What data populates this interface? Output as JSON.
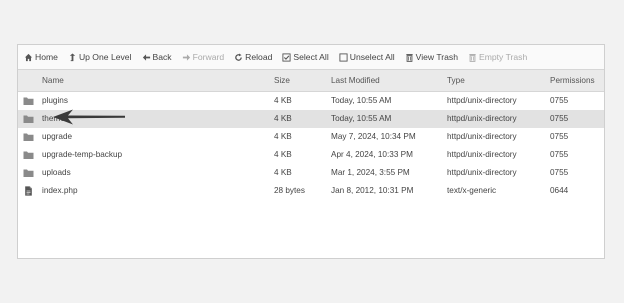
{
  "toolbar": {
    "home": "Home",
    "up_one_level": "Up One Level",
    "back": "Back",
    "forward": "Forward",
    "reload": "Reload",
    "select_all": "Select All",
    "unselect_all": "Unselect All",
    "view_trash": "View Trash",
    "empty_trash": "Empty Trash"
  },
  "columns": {
    "name": "Name",
    "size": "Size",
    "last_modified": "Last Modified",
    "type": "Type",
    "permissions": "Permissions"
  },
  "files": [
    {
      "icon": "folder-icon",
      "name": "plugins",
      "size": "4 KB",
      "modified": "Today, 10:55 AM",
      "type": "httpd/unix-directory",
      "perms": "0755"
    },
    {
      "icon": "folder-icon",
      "name": "themes",
      "size": "4 KB",
      "modified": "Today, 10:55 AM",
      "type": "httpd/unix-directory",
      "perms": "0755"
    },
    {
      "icon": "folder-icon",
      "name": "upgrade",
      "size": "4 KB",
      "modified": "May 7, 2024, 10:34 PM",
      "type": "httpd/unix-directory",
      "perms": "0755"
    },
    {
      "icon": "folder-icon",
      "name": "upgrade-temp-backup",
      "size": "4 KB",
      "modified": "Apr 4, 2024, 10:33 PM",
      "type": "httpd/unix-directory",
      "perms": "0755"
    },
    {
      "icon": "folder-icon",
      "name": "uploads",
      "size": "4 KB",
      "modified": "Mar 1, 2024, 3:55 PM",
      "type": "httpd/unix-directory",
      "perms": "0755"
    },
    {
      "icon": "file-icon",
      "name": "index.php",
      "size": "28 bytes",
      "modified": "Jan 8, 2012, 10:31 PM",
      "type": "text/x-generic",
      "perms": "0644"
    }
  ],
  "colors": {
    "selected_row": "#e2e2e2",
    "folder": "#8a8a8a",
    "arrow": "#3a3a3a"
  }
}
